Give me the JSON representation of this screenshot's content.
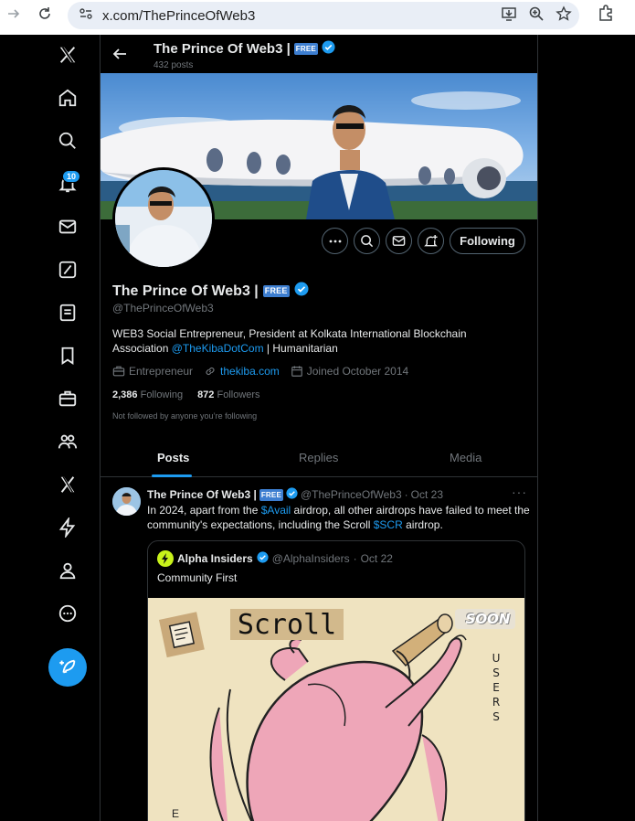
{
  "browser": {
    "url": "x.com/ThePrinceOfWeb3"
  },
  "nav": {
    "notifications_badge": "10"
  },
  "header": {
    "name": "The Prince Of Web3 |",
    "free_badge": "FREE",
    "posts_count": "432 posts"
  },
  "actions": {
    "following_label": "Following"
  },
  "profile": {
    "name": "The Prince Of Web3 |",
    "free_badge": "FREE",
    "handle": "@ThePrinceOfWeb3",
    "bio_line1": "WEB3 Social Entrepreneur, President at Kolkata International Blockchain",
    "bio_line2_prefix": "Association ",
    "bio_mention": "@TheKibaDotCom",
    "bio_line2_suffix": " | Humanitarian",
    "category": "Entrepreneur",
    "website": "thekiba.com",
    "joined": "Joined October 2014",
    "following_count": "2,386",
    "following_label": "Following",
    "followers_count": "872",
    "followers_label": "Followers",
    "not_followed": "Not followed by anyone you’re following"
  },
  "tabs": [
    {
      "label": "Posts"
    },
    {
      "label": "Replies"
    },
    {
      "label": "Media"
    }
  ],
  "tweet": {
    "author": "The Prince Of Web3 |",
    "free_badge": "FREE",
    "handle": "@ThePrinceOfWeb3",
    "sep": "·",
    "date": "Oct 23",
    "more": "···",
    "text_part1": "In 2024, apart from the ",
    "cashtag1": "$Avail",
    "text_part2": " airdrop, all other airdrops have failed to meet the community's expectations, including the Scroll ",
    "cashtag2": "$SCR",
    "text_part3": " airdrop.",
    "quote": {
      "author": "Alpha Insiders",
      "handle": "@AlphaInsiders",
      "sep": "·",
      "date": "Oct 22",
      "text": "Community First",
      "image": {
        "title": "Scroll",
        "soon": "SOON",
        "users_vertical": "USERS",
        "corner_letter": "E"
      }
    }
  },
  "colors": {
    "accent": "#1d9bf0",
    "background": "#000000",
    "text": "#e7e9ea",
    "muted": "#71767b",
    "border": "#2f3336"
  }
}
